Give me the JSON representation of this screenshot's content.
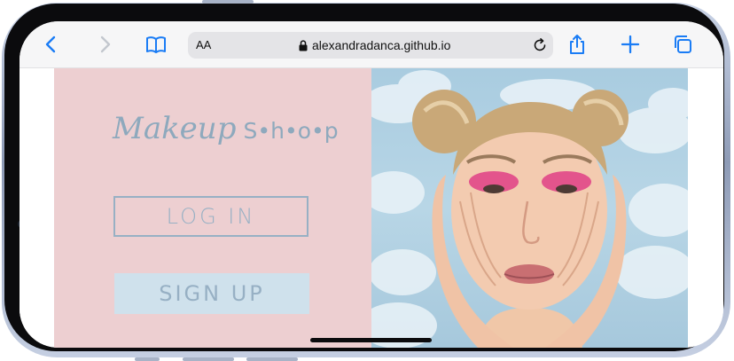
{
  "browser": {
    "aa_label": "AA",
    "url": "alexandradanca.github.io",
    "icons": {
      "back": "chevron-left-icon",
      "forward": "chevron-right-icon",
      "bookmarks": "book-icon",
      "lock": "lock-icon",
      "reload": "reload-icon",
      "share": "share-icon",
      "new_tab": "plus-icon",
      "tabs": "tabs-icon"
    },
    "accent_color": "#1a7cf5"
  },
  "page": {
    "logo_script": "Makeup",
    "logo_shop": "S•h•o•p",
    "login_label": "LOG IN",
    "signup_label": "SIGN UP",
    "left_panel_color": "#edcfd1",
    "brand_text_color": "#97b0c4",
    "signup_bg_color": "#cfe1ec",
    "hero_image": "woman-with-pink-eyeshadow-photo"
  }
}
